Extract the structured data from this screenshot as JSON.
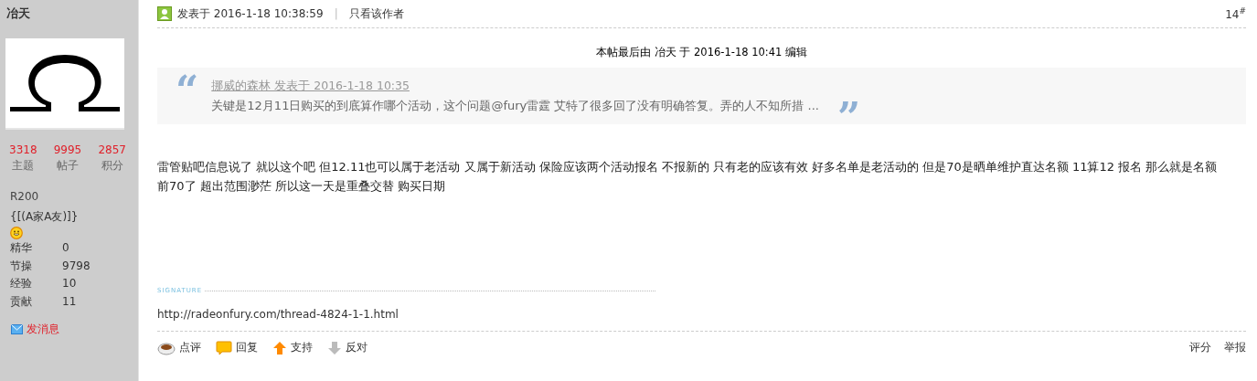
{
  "author": {
    "name": "冶天",
    "stats": [
      {
        "value": "3318",
        "label": "主题"
      },
      {
        "value": "9995",
        "label": "帖子"
      },
      {
        "value": "2857",
        "label": "积分"
      }
    ],
    "rank": "R200",
    "group": "{[(A家A友)]}",
    "details": [
      {
        "label": "精华",
        "value": "0"
      },
      {
        "label": "节操",
        "value": "9798"
      },
      {
        "label": "经验",
        "value": "10"
      },
      {
        "label": "贡献",
        "value": "11"
      }
    ],
    "message_link": "发消息"
  },
  "post": {
    "posted": "发表于 2016-1-18 10:38:59",
    "separator": "|",
    "only_author": "只看该作者",
    "floor": "14",
    "floor_mark": "#",
    "edit_note": "本帖最后由 冶天 于 2016-1-18 10:41 编辑",
    "quote": {
      "open_mark": "“",
      "close_mark": "”",
      "source": "挪威的森林 发表于 2016-1-18 10:35",
      "text": "关键是12月11日购买的到底算作哪个活动，这个问题@fury雷霆 艾特了很多回了没有明确答复。弄的人不知所措 ..."
    },
    "body": "雷管贴吧信息说了 就以这个吧 但12.11也可以属于老活动 又属于新活动 保险应该两个活动报名 不报新的 只有老的应该有效 好多名单是老活动的 但是70是晒单维护直达名额 11算12 报名 那么就是名额前70了 超出范围渺茫 所以这一天是重叠交替 购买日期",
    "signature_label": "SIGNATURE",
    "signature": "http://radeonfury.com/thread-4824-1-1.html"
  },
  "actions": [
    {
      "kind": "comment",
      "label": "点评"
    },
    {
      "kind": "reply",
      "label": "回复"
    },
    {
      "kind": "support",
      "label": "支持"
    },
    {
      "kind": "oppose",
      "label": "反对"
    }
  ],
  "right_actions": [
    "评分",
    "举报"
  ]
}
